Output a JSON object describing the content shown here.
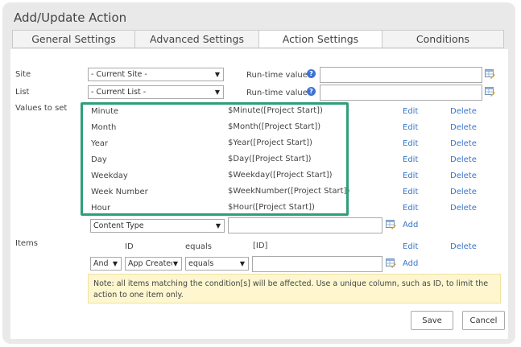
{
  "dialog": {
    "title": "Add/Update Action"
  },
  "tabs": [
    {
      "label": "General Settings"
    },
    {
      "label": "Advanced Settings"
    },
    {
      "label": "Action Settings",
      "active": true
    },
    {
      "label": "Conditions"
    }
  ],
  "site": {
    "label": "Site",
    "value": "- Current Site -",
    "runtime_label": "Run-time value",
    "runtime_value": ""
  },
  "list": {
    "label": "List",
    "value": "- Current List -",
    "runtime_label": "Run-time value",
    "runtime_value": ""
  },
  "values_to_set": {
    "label": "Values to set",
    "rows": [
      {
        "field": "Minute",
        "value": "$Minute([Project Start])",
        "edit": "Edit",
        "delete": "Delete"
      },
      {
        "field": "Month",
        "value": "$Month([Project Start])",
        "edit": "Edit",
        "delete": "Delete"
      },
      {
        "field": "Year",
        "value": "$Year([Project Start])",
        "edit": "Edit",
        "delete": "Delete"
      },
      {
        "field": "Day",
        "value": "$Day([Project Start])",
        "edit": "Edit",
        "delete": "Delete"
      },
      {
        "field": "Weekday",
        "value": "$Weekday([Project Start])",
        "edit": "Edit",
        "delete": "Delete"
      },
      {
        "field": "Week Number",
        "value": "$WeekNumber([Project Start])",
        "edit": "Edit",
        "delete": "Delete"
      },
      {
        "field": "Hour",
        "value": "$Hour([Project Start])",
        "edit": "Edit",
        "delete": "Delete"
      }
    ],
    "new_field": "Content Type",
    "new_value": "",
    "add": "Add"
  },
  "items": {
    "label": "Items",
    "header": {
      "field": "ID",
      "operator": "equals",
      "value": "[ID]",
      "edit": "Edit",
      "delete": "Delete"
    },
    "join": "And",
    "field": "App Created",
    "operator": "equals",
    "value": "",
    "add": "Add"
  },
  "note": "Note: all items matching the condition[s] will be affected. Use a unique column, such as ID, to limit the action to one item only.",
  "buttons": {
    "save": "Save",
    "cancel": "Cancel"
  },
  "colors": {
    "highlight": "#2e9e7b",
    "link": "#3875c9",
    "note_bg": "#fdf6cf",
    "help": "#3f73d6"
  },
  "icons": {
    "help": "question-circle-icon",
    "table": "table-picker-icon"
  }
}
